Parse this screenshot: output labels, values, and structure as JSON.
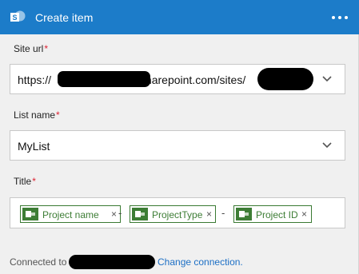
{
  "header": {
    "title": "Create item",
    "bg_color": "#1c7cc9",
    "logo_icon": "sharepoint-logo-icon",
    "menu_icon": "ellipsis-icon"
  },
  "site_url": {
    "label": "Site url",
    "required_mark": "*",
    "value_prefix": "https://",
    "value_mid": ".sharepoint.com/sites/",
    "dropdown_icon": "chevron-down-icon"
  },
  "list_name": {
    "label": "List name",
    "required_mark": "*",
    "value": "MyList",
    "dropdown_icon": "chevron-down-icon"
  },
  "title_field": {
    "label": "Title",
    "required_mark": "*",
    "tokens": [
      {
        "label": "Project name",
        "remove": "×"
      },
      {
        "label": "ProjectType",
        "remove": "×"
      },
      {
        "label": "Project ID",
        "remove": "×"
      }
    ],
    "separators": [
      "-",
      "-"
    ],
    "token_color": "#3d7d35"
  },
  "footer": {
    "connected_label": "Connected to",
    "change_link": "Change connection."
  }
}
